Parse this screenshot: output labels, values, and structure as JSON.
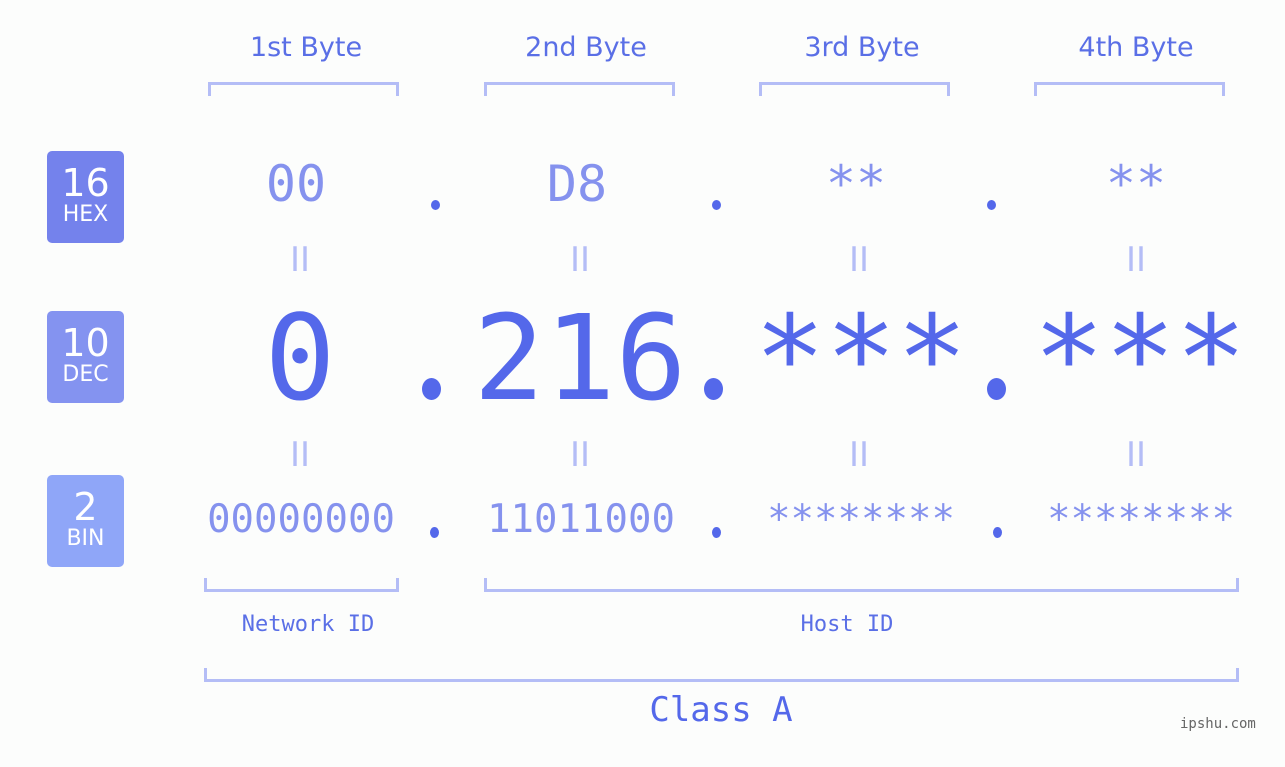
{
  "bytes": {
    "headers": [
      "1st Byte",
      "2nd Byte",
      "3rd Byte",
      "4th Byte"
    ]
  },
  "badges": {
    "hex": {
      "num": "16",
      "label": "HEX",
      "color": "#7482ec"
    },
    "dec": {
      "num": "10",
      "label": "DEC",
      "color": "#8493f0"
    },
    "bin": {
      "num": "2",
      "label": "BIN",
      "color": "#8fa6f8"
    }
  },
  "hex": [
    "00",
    "D8",
    "**",
    "**"
  ],
  "dec": [
    "0",
    "216",
    "***",
    "***"
  ],
  "bin": [
    "00000000",
    "11011000",
    "********",
    "********"
  ],
  "equals_sign": "II",
  "segments": {
    "network": "Network ID",
    "host": "Host ID"
  },
  "ip_class": "Class A",
  "watermark": "ipshu.com",
  "colors": {
    "accent": "#5468ea",
    "light": "#8592ee",
    "bracket": "#b4bdf6",
    "background": "#fcfdfc"
  }
}
